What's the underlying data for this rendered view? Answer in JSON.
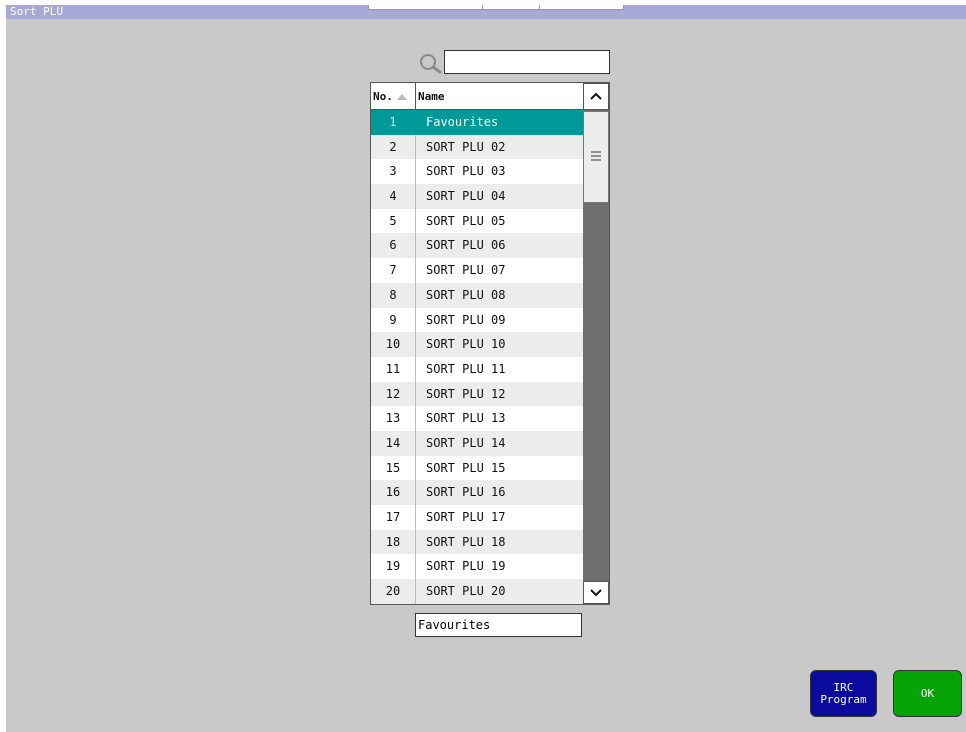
{
  "window": {
    "title": "Sort PLU"
  },
  "search": {
    "value": "",
    "placeholder": ""
  },
  "list": {
    "headers": {
      "no": "No.",
      "name": "Name"
    },
    "rows": [
      {
        "no": "1",
        "name": "Favourites",
        "selected": true
      },
      {
        "no": "2",
        "name": "SORT PLU 02"
      },
      {
        "no": "3",
        "name": "SORT PLU 03"
      },
      {
        "no": "4",
        "name": "SORT PLU 04"
      },
      {
        "no": "5",
        "name": "SORT PLU 05"
      },
      {
        "no": "6",
        "name": "SORT PLU 06"
      },
      {
        "no": "7",
        "name": "SORT PLU 07"
      },
      {
        "no": "8",
        "name": "SORT PLU 08"
      },
      {
        "no": "9",
        "name": "SORT PLU 09"
      },
      {
        "no": "10",
        "name": "SORT PLU 10"
      },
      {
        "no": "11",
        "name": "SORT PLU 11"
      },
      {
        "no": "12",
        "name": "SORT PLU 12"
      },
      {
        "no": "13",
        "name": "SORT PLU 13"
      },
      {
        "no": "14",
        "name": "SORT PLU 14"
      },
      {
        "no": "15",
        "name": "SORT PLU 15"
      },
      {
        "no": "16",
        "name": "SORT PLU 16"
      },
      {
        "no": "17",
        "name": "SORT PLU 17"
      },
      {
        "no": "18",
        "name": "SORT PLU 18"
      },
      {
        "no": "19",
        "name": "SORT PLU 19"
      },
      {
        "no": "20",
        "name": "SORT PLU 20"
      }
    ]
  },
  "selected_name": "Favourites",
  "buttons": {
    "irc_program": "IRC\nProgram",
    "ok": "OK"
  },
  "colors": {
    "titlebar": "#a9a9d8",
    "selected_row": "#009999",
    "irc_button": "#0a0a9e",
    "ok_button": "#07a307"
  },
  "icons": {
    "search": "search-icon",
    "scroll_up": "chevron-up-icon",
    "scroll_down": "chevron-down-icon",
    "thumb": "grip-lines-icon",
    "sort": "sort-ascending-icon"
  }
}
